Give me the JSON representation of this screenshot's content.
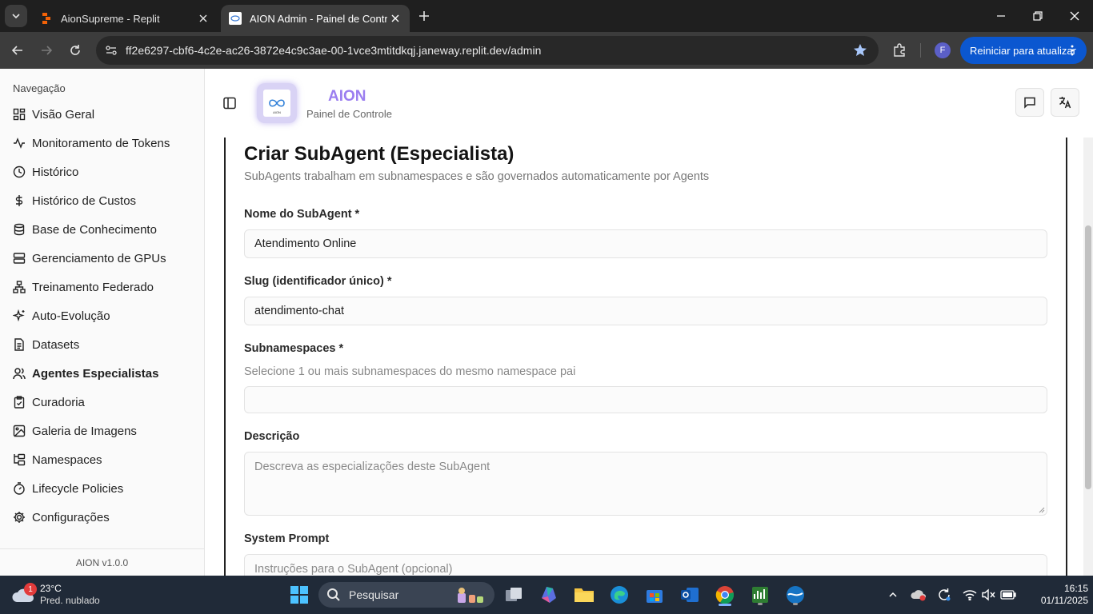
{
  "browser": {
    "tabs": [
      {
        "title": "AionSupreme - Replit",
        "active": false
      },
      {
        "title": "AION Admin - Painel de Controle",
        "active": true
      }
    ],
    "url": "ff2e6297-cbf6-4c2e-ac26-3872e4c9c3ae-00-1vce3mtitdkqj.janeway.replit.dev/admin",
    "profile_initial": "F",
    "update_button": "Reiniciar para atualizar"
  },
  "sidebar": {
    "group_label": "Navegação",
    "items": [
      {
        "label": "Visão Geral",
        "icon": "dashboard-grid-icon"
      },
      {
        "label": "Monitoramento de Tokens",
        "icon": "activity-icon"
      },
      {
        "label": "Histórico",
        "icon": "clock-icon"
      },
      {
        "label": "Histórico de Custos",
        "icon": "dollar-icon"
      },
      {
        "label": "Base de Conhecimento",
        "icon": "database-icon"
      },
      {
        "label": "Gerenciamento de GPUs",
        "icon": "server-icon"
      },
      {
        "label": "Treinamento Federado",
        "icon": "network-icon"
      },
      {
        "label": "Auto-Evolução",
        "icon": "sparkles-icon"
      },
      {
        "label": "Datasets",
        "icon": "file-text-icon"
      },
      {
        "label": "Agentes Especialistas",
        "icon": "users-icon",
        "active": true
      },
      {
        "label": "Curadoria",
        "icon": "clipboard-check-icon"
      },
      {
        "label": "Galeria de Imagens",
        "icon": "image-icon"
      },
      {
        "label": "Namespaces",
        "icon": "folder-tree-icon"
      },
      {
        "label": "Lifecycle Policies",
        "icon": "timer-icon"
      },
      {
        "label": "Configurações",
        "icon": "gear-icon"
      }
    ],
    "footer": "AION v1.0.0"
  },
  "header": {
    "brand_title": "AION",
    "brand_subtitle": "Painel de Controle",
    "logo_text": "AION"
  },
  "form": {
    "title": "Criar SubAgent (Especialista)",
    "description": "SubAgents trabalham em subnamespaces e são governados automaticamente por Agents",
    "name_label": "Nome do SubAgent *",
    "name_value": "Atendimento Online",
    "slug_label": "Slug (identificador único) *",
    "slug_value": "atendimento-chat",
    "subnamespaces_label": "Subnamespaces *",
    "subnamespaces_hint": "Selecione 1 ou mais subnamespaces do mesmo namespace pai",
    "subnamespaces_value": "",
    "description_label": "Descrição",
    "description_placeholder": "Descreva as especializações deste SubAgent",
    "system_prompt_label": "System Prompt",
    "system_prompt_placeholder": "Instruções para o SubAgent (opcional)"
  },
  "taskbar": {
    "weather_badge": "1",
    "temperature": "23°C",
    "condition": "Pred. nublado",
    "search_label": "Pesquisar",
    "time": "16:15",
    "date": "01/11/2025"
  },
  "colors": {
    "brand_purple": "#9b7ef0",
    "browser_dark": "#1f1f1f",
    "update_blue": "#0b57d0",
    "taskbar": "#202a38"
  }
}
